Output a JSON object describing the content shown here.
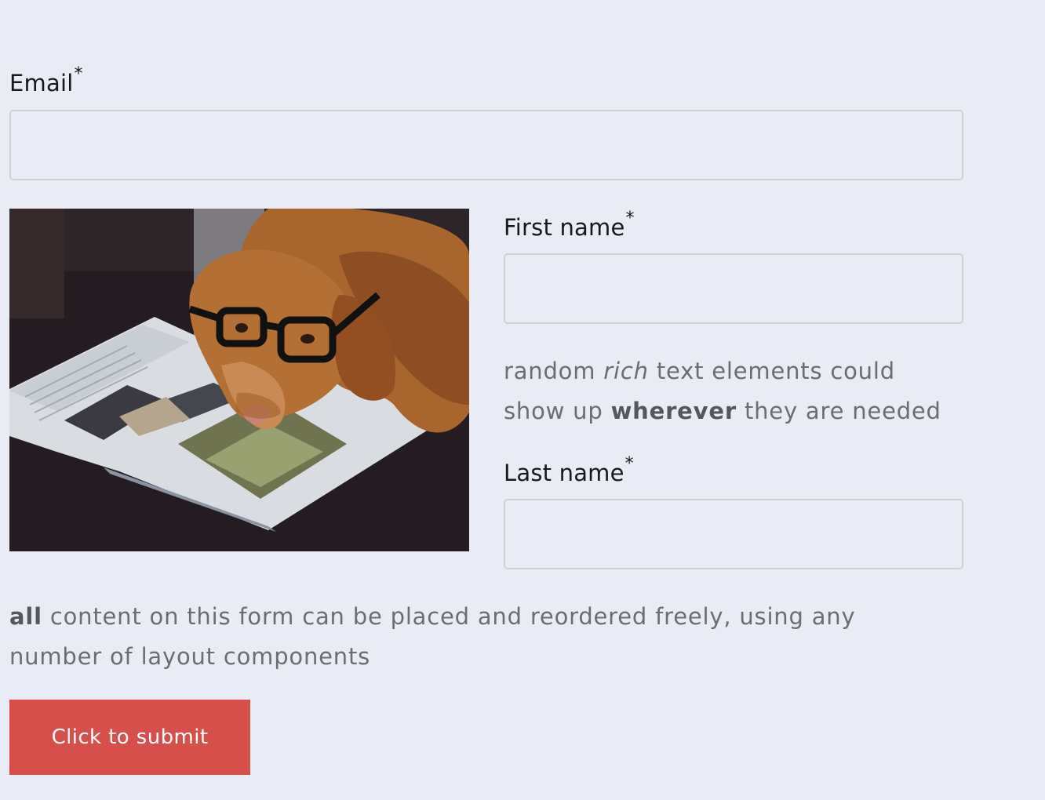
{
  "form": {
    "email": {
      "label": "Email",
      "required_marker": "*",
      "value": "",
      "placeholder": ""
    },
    "first_name": {
      "label": "First name",
      "required_marker": "*",
      "value": "",
      "placeholder": ""
    },
    "last_name": {
      "label": "Last name",
      "required_marker": "*",
      "value": "",
      "placeholder": ""
    },
    "rich_text_1": {
      "part1": "random ",
      "italic": "rich",
      "part2": " text elements could show up ",
      "bold": "wherever",
      "part3": " they are needed"
    },
    "rich_text_2": {
      "bold": "all",
      "rest": " content on this form can be placed and reordered freely, using any number of layout components"
    },
    "image": {
      "subject": "dog-with-glasses-reading-magazine"
    },
    "submit_label": "Click to submit"
  },
  "colors": {
    "background": "#e9ecf4",
    "input_border": "#cfd1d8",
    "submit_button": "#d64f4a",
    "muted_text": "#6b6d73"
  }
}
